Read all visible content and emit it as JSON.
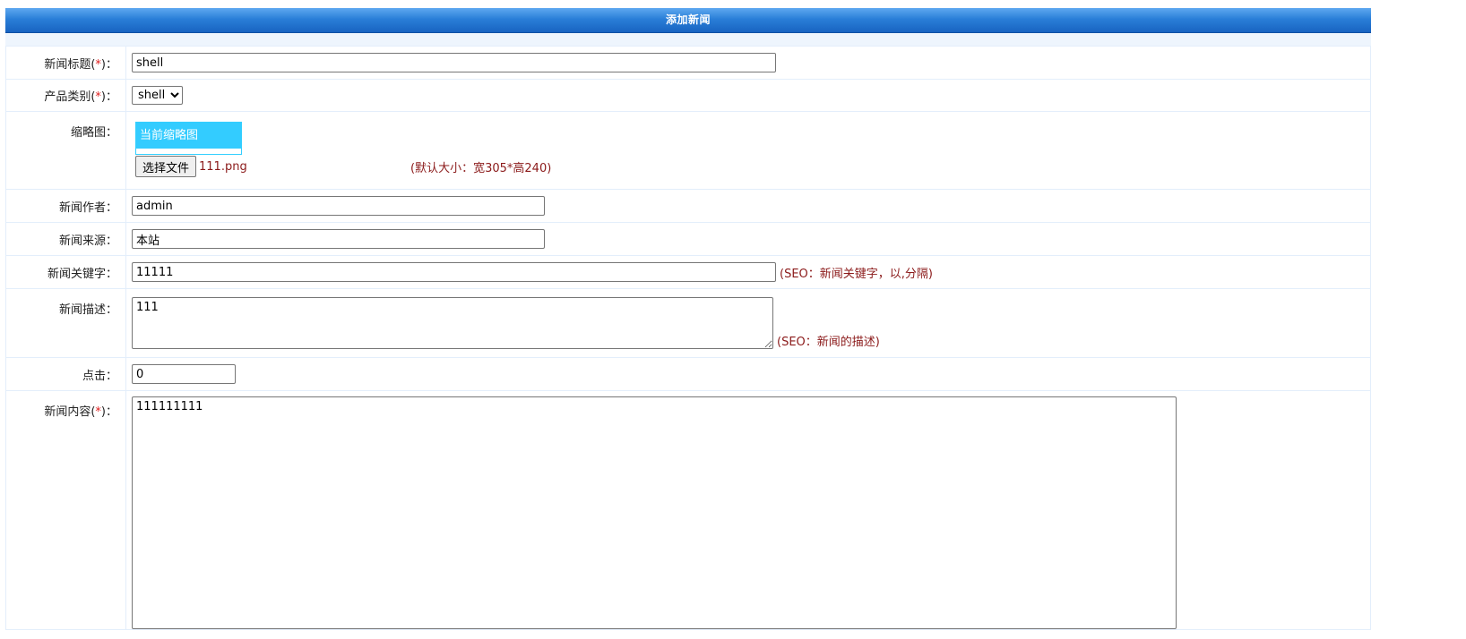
{
  "page": {
    "title": "添加新闻"
  },
  "form": {
    "title_field": {
      "label": "新闻标题",
      "required": "*",
      "value": "shell"
    },
    "category_field": {
      "label": "产品类别",
      "required": "*",
      "selected": "shell"
    },
    "thumbnail_field": {
      "label": "缩略图：",
      "current_label": "当前缩略图",
      "choose_button": "选择文件",
      "file_name": "111.png",
      "hint": "(默认大小：宽305*高240)"
    },
    "author_field": {
      "label": "新闻作者：",
      "value": "admin"
    },
    "source_field": {
      "label": "新闻来源：",
      "value": "本站"
    },
    "keywords_field": {
      "label": "新闻关键字：",
      "value": "11111",
      "hint": "(SEO：新闻关键字，以,分隔)"
    },
    "description_field": {
      "label": "新闻描述：",
      "value": "111",
      "hint": "(SEO：新闻的描述)"
    },
    "clicks_field": {
      "label": "点击：",
      "value": "0"
    },
    "content_field": {
      "label": "新闻内容",
      "required": "*",
      "value": "111111111"
    }
  },
  "colors": {
    "title_bar": "#2a7fd8",
    "hint_text": "#8b1a1a",
    "required_mark": "#e02020",
    "thumbnail_header": "#33ccff"
  }
}
